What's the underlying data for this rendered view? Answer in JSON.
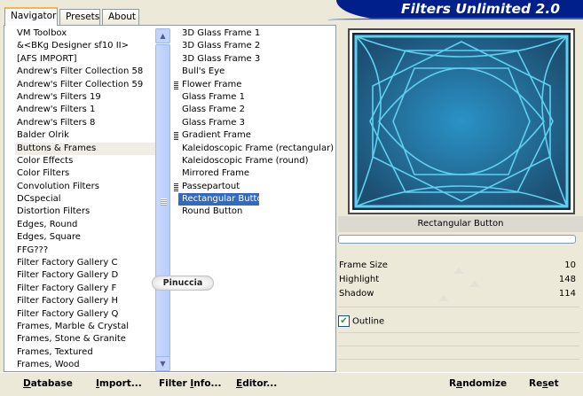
{
  "tabs": [
    {
      "label": "Navigator",
      "active": true
    },
    {
      "label": "Presets",
      "active": false
    },
    {
      "label": "About",
      "active": false
    }
  ],
  "banner_title": "Filters Unlimited 2.0",
  "categories": [
    "VM Toolbox",
    "&<BKg Designer sf10 II>",
    "[AFS IMPORT]",
    "Andrew's Filter Collection 58",
    "Andrew's Filter Collection 59",
    "Andrew's Filters 19",
    "Andrew's Filters 1",
    "Andrew's Filters 8",
    "Balder Olrik",
    "Buttons & Frames",
    "Color Effects",
    "Color Filters",
    "Convolution Filters",
    "DCspecial",
    "Distortion Filters",
    "Edges, Round",
    "Edges, Square",
    "FFG???",
    "Filter Factory Gallery C",
    "Filter Factory Gallery D",
    "Filter Factory Gallery F",
    "Filter Factory Gallery H",
    "Filter Factory Gallery Q",
    "Frames, Marble & Crystal",
    "Frames, Stone & Granite",
    "Frames, Textured",
    "Frames, Wood"
  ],
  "selected_category": "Buttons & Frames",
  "filters": [
    {
      "label": "3D Glass Frame 1",
      "group": false
    },
    {
      "label": "3D Glass Frame 2",
      "group": false
    },
    {
      "label": "3D Glass Frame 3",
      "group": false
    },
    {
      "label": "Bull's Eye",
      "group": false
    },
    {
      "label": "Flower Frame",
      "group": true
    },
    {
      "label": "Glass Frame 1",
      "group": false
    },
    {
      "label": "Glass Frame 2",
      "group": false
    },
    {
      "label": "Glass Frame 3",
      "group": false
    },
    {
      "label": "Gradient Frame",
      "group": true
    },
    {
      "label": "Kaleidoscopic Frame (rectangular)",
      "group": false
    },
    {
      "label": "Kaleidoscopic Frame (round)",
      "group": false
    },
    {
      "label": "Mirrored Frame",
      "group": false
    },
    {
      "label": "Passepartout",
      "group": true
    },
    {
      "label": "Rectangular Button",
      "group": false
    },
    {
      "label": "Round Button",
      "group": false
    }
  ],
  "selected_filter": "Rectangular Button",
  "watermark": "Pinuccia",
  "preview": {
    "label": "Rectangular Button",
    "colors": {
      "center": "#2a93c7",
      "edge": "#1d4f72",
      "frame": "#5fd0f0",
      "border": "#0e2d44"
    }
  },
  "params": [
    {
      "label": "Frame Size",
      "value": "10",
      "level": 10
    },
    {
      "label": "Highlight",
      "value": "148",
      "level": 148
    },
    {
      "label": "Shadow",
      "value": "114",
      "level": 114
    }
  ],
  "outline": {
    "label": "Outline",
    "checked": true
  },
  "buttons": {
    "database": {
      "accel": "D",
      "rest": "atabase"
    },
    "import": {
      "accel": "I",
      "rest": "mport..."
    },
    "filter_info": {
      "pre": "Filter ",
      "accel": "I",
      "rest": "nfo..."
    },
    "editor": {
      "accel": "E",
      "rest": "ditor..."
    },
    "randomize": {
      "pre": "R",
      "accel": "a",
      "rest": "ndomize"
    },
    "reset": {
      "pre": "Re",
      "accel": "s",
      "rest": "et"
    }
  }
}
